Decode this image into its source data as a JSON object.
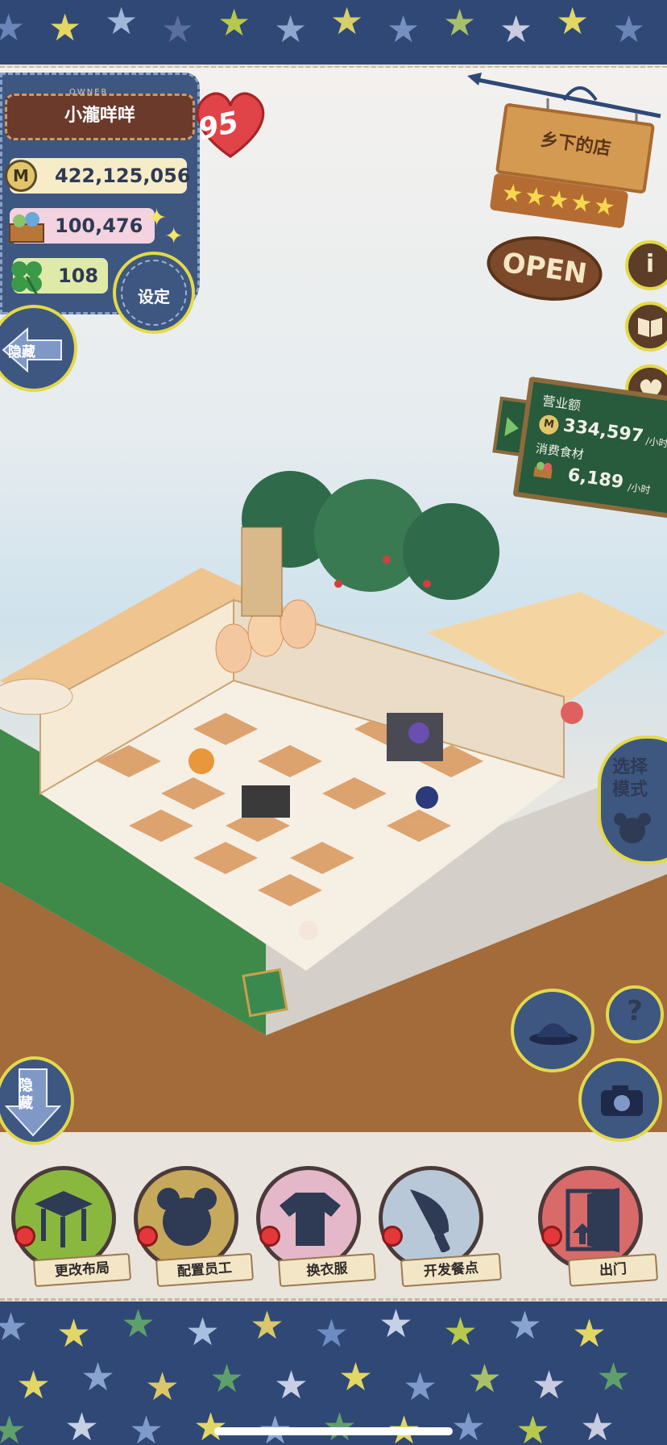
{
  "owner": {
    "caption": "OWNER",
    "name": "小瀧咩咩",
    "level": "95",
    "coins": "422,125,056",
    "ingredients": "100,476",
    "clovers": "108",
    "settings_label": "设定",
    "hide_label": "隐藏"
  },
  "shop": {
    "name": "乡下的店",
    "stars": "★★★★★",
    "open_label": "OPEN",
    "info_icon_text": "i"
  },
  "stats": {
    "revenue_label": "营业额",
    "revenue_value": "334,597",
    "revenue_unit": "/小时",
    "consumption_label": "消费食材",
    "consumption_value": "6,189",
    "consumption_unit": "/小时"
  },
  "mode": {
    "select_label": "选择模式",
    "hide_label": "隐藏",
    "help_icon_text": "?"
  },
  "bottom_menu": [
    {
      "label": "更改布局",
      "icon": "table-icon"
    },
    {
      "label": "配置员工",
      "icon": "bear-icon"
    },
    {
      "label": "换衣服",
      "icon": "shirt-icon"
    },
    {
      "label": "开发餐点",
      "icon": "knife-icon"
    },
    {
      "label": "出门",
      "icon": "door-icon"
    }
  ],
  "colors": {
    "denim": "#3e5781",
    "accent_yellow": "#e3d94a",
    "chalkboard": "#285a3c",
    "wood": "#d59a52",
    "heart": "#e04448"
  }
}
